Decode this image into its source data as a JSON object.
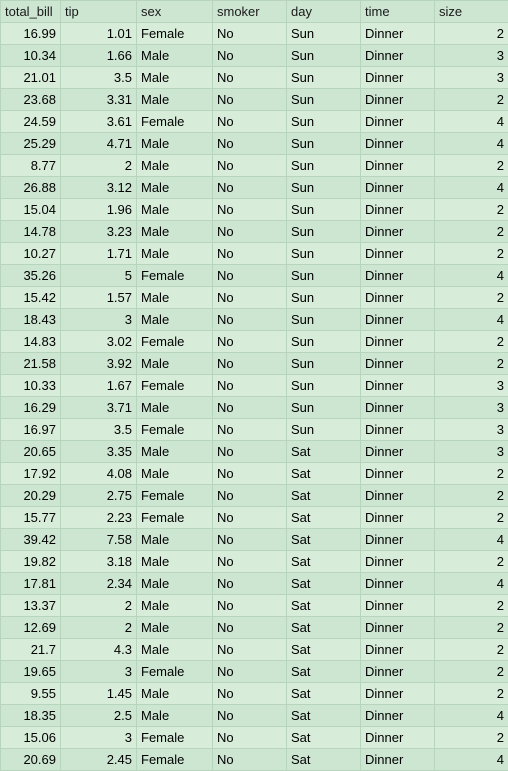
{
  "table": {
    "headers": [
      "total_bill",
      "tip",
      "sex",
      "smoker",
      "day",
      "time",
      "size"
    ],
    "column_types": [
      "num",
      "num",
      "txt",
      "txt",
      "txt",
      "txt",
      "num"
    ],
    "rows": [
      [
        "16.99",
        "1.01",
        "Female",
        "No",
        "Sun",
        "Dinner",
        "2"
      ],
      [
        "10.34",
        "1.66",
        "Male",
        "No",
        "Sun",
        "Dinner",
        "3"
      ],
      [
        "21.01",
        "3.5",
        "Male",
        "No",
        "Sun",
        "Dinner",
        "3"
      ],
      [
        "23.68",
        "3.31",
        "Male",
        "No",
        "Sun",
        "Dinner",
        "2"
      ],
      [
        "24.59",
        "3.61",
        "Female",
        "No",
        "Sun",
        "Dinner",
        "4"
      ],
      [
        "25.29",
        "4.71",
        "Male",
        "No",
        "Sun",
        "Dinner",
        "4"
      ],
      [
        "8.77",
        "2",
        "Male",
        "No",
        "Sun",
        "Dinner",
        "2"
      ],
      [
        "26.88",
        "3.12",
        "Male",
        "No",
        "Sun",
        "Dinner",
        "4"
      ],
      [
        "15.04",
        "1.96",
        "Male",
        "No",
        "Sun",
        "Dinner",
        "2"
      ],
      [
        "14.78",
        "3.23",
        "Male",
        "No",
        "Sun",
        "Dinner",
        "2"
      ],
      [
        "10.27",
        "1.71",
        "Male",
        "No",
        "Sun",
        "Dinner",
        "2"
      ],
      [
        "35.26",
        "5",
        "Female",
        "No",
        "Sun",
        "Dinner",
        "4"
      ],
      [
        "15.42",
        "1.57",
        "Male",
        "No",
        "Sun",
        "Dinner",
        "2"
      ],
      [
        "18.43",
        "3",
        "Male",
        "No",
        "Sun",
        "Dinner",
        "4"
      ],
      [
        "14.83",
        "3.02",
        "Female",
        "No",
        "Sun",
        "Dinner",
        "2"
      ],
      [
        "21.58",
        "3.92",
        "Male",
        "No",
        "Sun",
        "Dinner",
        "2"
      ],
      [
        "10.33",
        "1.67",
        "Female",
        "No",
        "Sun",
        "Dinner",
        "3"
      ],
      [
        "16.29",
        "3.71",
        "Male",
        "No",
        "Sun",
        "Dinner",
        "3"
      ],
      [
        "16.97",
        "3.5",
        "Female",
        "No",
        "Sun",
        "Dinner",
        "3"
      ],
      [
        "20.65",
        "3.35",
        "Male",
        "No",
        "Sat",
        "Dinner",
        "3"
      ],
      [
        "17.92",
        "4.08",
        "Male",
        "No",
        "Sat",
        "Dinner",
        "2"
      ],
      [
        "20.29",
        "2.75",
        "Female",
        "No",
        "Sat",
        "Dinner",
        "2"
      ],
      [
        "15.77",
        "2.23",
        "Female",
        "No",
        "Sat",
        "Dinner",
        "2"
      ],
      [
        "39.42",
        "7.58",
        "Male",
        "No",
        "Sat",
        "Dinner",
        "4"
      ],
      [
        "19.82",
        "3.18",
        "Male",
        "No",
        "Sat",
        "Dinner",
        "2"
      ],
      [
        "17.81",
        "2.34",
        "Male",
        "No",
        "Sat",
        "Dinner",
        "4"
      ],
      [
        "13.37",
        "2",
        "Male",
        "No",
        "Sat",
        "Dinner",
        "2"
      ],
      [
        "12.69",
        "2",
        "Male",
        "No",
        "Sat",
        "Dinner",
        "2"
      ],
      [
        "21.7",
        "4.3",
        "Male",
        "No",
        "Sat",
        "Dinner",
        "2"
      ],
      [
        "19.65",
        "3",
        "Female",
        "No",
        "Sat",
        "Dinner",
        "2"
      ],
      [
        "9.55",
        "1.45",
        "Male",
        "No",
        "Sat",
        "Dinner",
        "2"
      ],
      [
        "18.35",
        "2.5",
        "Male",
        "No",
        "Sat",
        "Dinner",
        "4"
      ],
      [
        "15.06",
        "3",
        "Female",
        "No",
        "Sat",
        "Dinner",
        "2"
      ],
      [
        "20.69",
        "2.45",
        "Female",
        "No",
        "Sat",
        "Dinner",
        "4"
      ]
    ]
  }
}
